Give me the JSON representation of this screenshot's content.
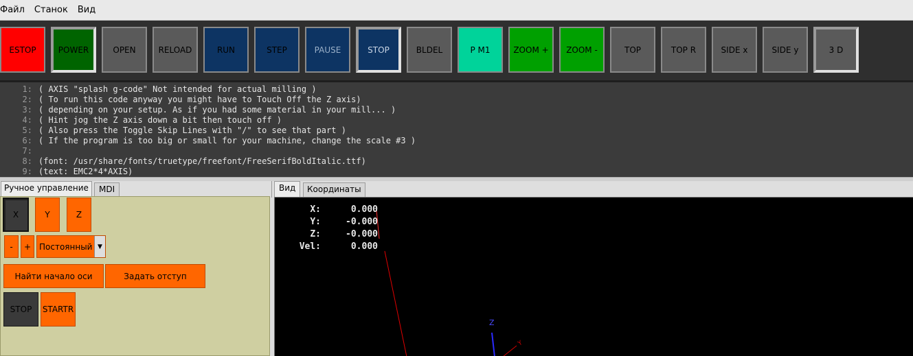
{
  "menubar": {
    "items": [
      "Файл",
      "Станок",
      "Вид"
    ]
  },
  "toolbar": {
    "buttons": [
      {
        "label": "ESTOP",
        "bg": "#ff0000",
        "fg": "#000000"
      },
      {
        "label": "POWER",
        "bg": "#006400",
        "fg": "#000000",
        "sunken": true
      },
      {
        "label": "OPEN",
        "bg": "#5a5a5a",
        "fg": "#000000"
      },
      {
        "label": "RELOAD",
        "bg": "#5a5a5a",
        "fg": "#000000"
      },
      {
        "label": "RUN",
        "bg": "#0d3463",
        "fg": "#000000"
      },
      {
        "label": "STEP",
        "bg": "#0d3463",
        "fg": "#000000"
      },
      {
        "label": "PAUSE",
        "bg": "#0d3463",
        "fg": "#9ab0c8"
      },
      {
        "label": "STOP",
        "bg": "#0d3463",
        "fg": "#c8d4e4",
        "sunken": true
      },
      {
        "label": "BLDEL",
        "bg": "#5a5a5a",
        "fg": "#000000"
      },
      {
        "label": "P M1",
        "bg": "#00d39a",
        "fg": "#000000"
      },
      {
        "label": "ZOOM +",
        "bg": "#00a000",
        "fg": "#000000"
      },
      {
        "label": "ZOOM -",
        "bg": "#00a000",
        "fg": "#000000"
      },
      {
        "label": "TOP",
        "bg": "#5a5a5a",
        "fg": "#000000"
      },
      {
        "label": "TOP R",
        "bg": "#5a5a5a",
        "fg": "#000000"
      },
      {
        "label": "SIDE x",
        "bg": "#5a5a5a",
        "fg": "#000000"
      },
      {
        "label": "SIDE y",
        "bg": "#5a5a5a",
        "fg": "#000000"
      },
      {
        "label": "3 D",
        "bg": "#5a5a5a",
        "fg": "#000000",
        "sunken": true
      }
    ]
  },
  "gcode": {
    "lines": [
      {
        "n": "1:",
        "text": "( AXIS \"splash g-code\" Not intended for actual milling )"
      },
      {
        "n": "2:",
        "text": "( To run this code anyway you might have to Touch Off the Z axis)"
      },
      {
        "n": "3:",
        "text": "( depending on your setup. As if you had some material in your mill... )"
      },
      {
        "n": "4:",
        "text": "( Hint jog the Z axis down a bit then touch off )"
      },
      {
        "n": "5:",
        "text": "( Also press the Toggle Skip Lines with \"/\" to see that part )"
      },
      {
        "n": "6:",
        "text": "( If the program is too big or small for your machine, change the scale #3 )"
      },
      {
        "n": "7:",
        "text": ""
      },
      {
        "n": "8:",
        "text": "(font: /usr/share/fonts/truetype/freefont/FreeSerifBoldItalic.ttf)"
      },
      {
        "n": "9:",
        "text": "(text: EMC2*4*AXIS)"
      }
    ]
  },
  "left_tabs": {
    "manual": "Ручное управление",
    "mdi": "MDI"
  },
  "manual": {
    "axes": [
      "X",
      "Y",
      "Z"
    ],
    "minus": "-",
    "plus": "+",
    "jog_mode": "Постоянный",
    "home_button": "Найти начало оси",
    "touchoff_button": "Задать отступ",
    "stop_button": "STOP",
    "start_button": "STARTR"
  },
  "right_tabs": {
    "preview": "Вид",
    "dro": "Координаты"
  },
  "dro": [
    {
      "label": "X:",
      "value": "0.000"
    },
    {
      "label": "Y:",
      "value": "-0.000"
    },
    {
      "label": "Z:",
      "value": "-0.000"
    },
    {
      "label": "Vel:",
      "value": "0.000"
    }
  ],
  "preview_axes": {
    "z": "Z",
    "y": "Y"
  },
  "icons": {
    "dropdown": "chevron-down-icon"
  }
}
